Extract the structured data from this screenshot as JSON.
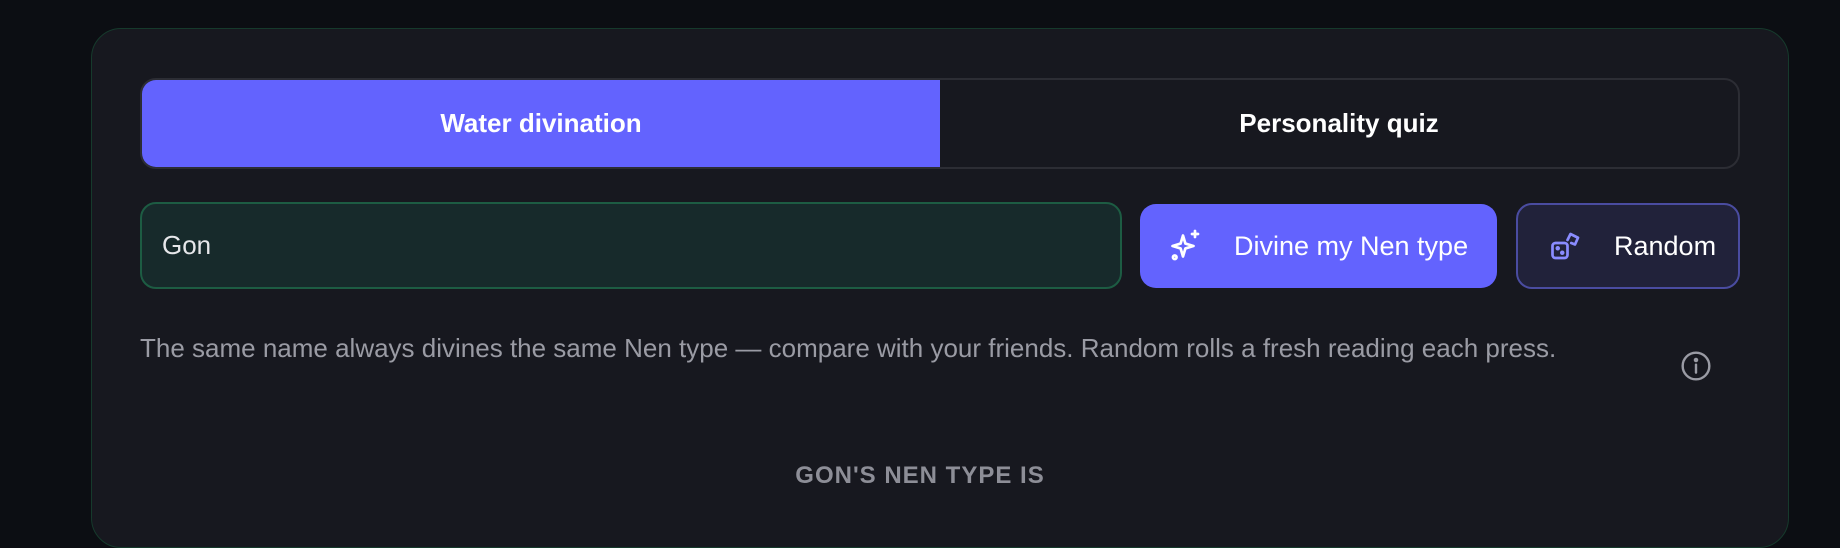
{
  "tabs": [
    {
      "label": "Water divination",
      "active": true
    },
    {
      "label": "Personality quiz",
      "active": false
    }
  ],
  "form": {
    "name_value": "Gon",
    "divine_label": "Divine my Nen type",
    "random_label": "Random"
  },
  "hint": "The same name always divines the same Nen type — compare with your friends. Random rolls a fresh reading each press.",
  "result": {
    "label": "GON'S NEN TYPE IS"
  },
  "icons": {
    "divine": "sparkles-icon",
    "random": "dice-icon",
    "info": "info-icon"
  },
  "colors": {
    "accent": "#6363fe",
    "input_bg": "#172a2b",
    "input_border": "#1d5c43",
    "card_bg": "#17181f"
  }
}
